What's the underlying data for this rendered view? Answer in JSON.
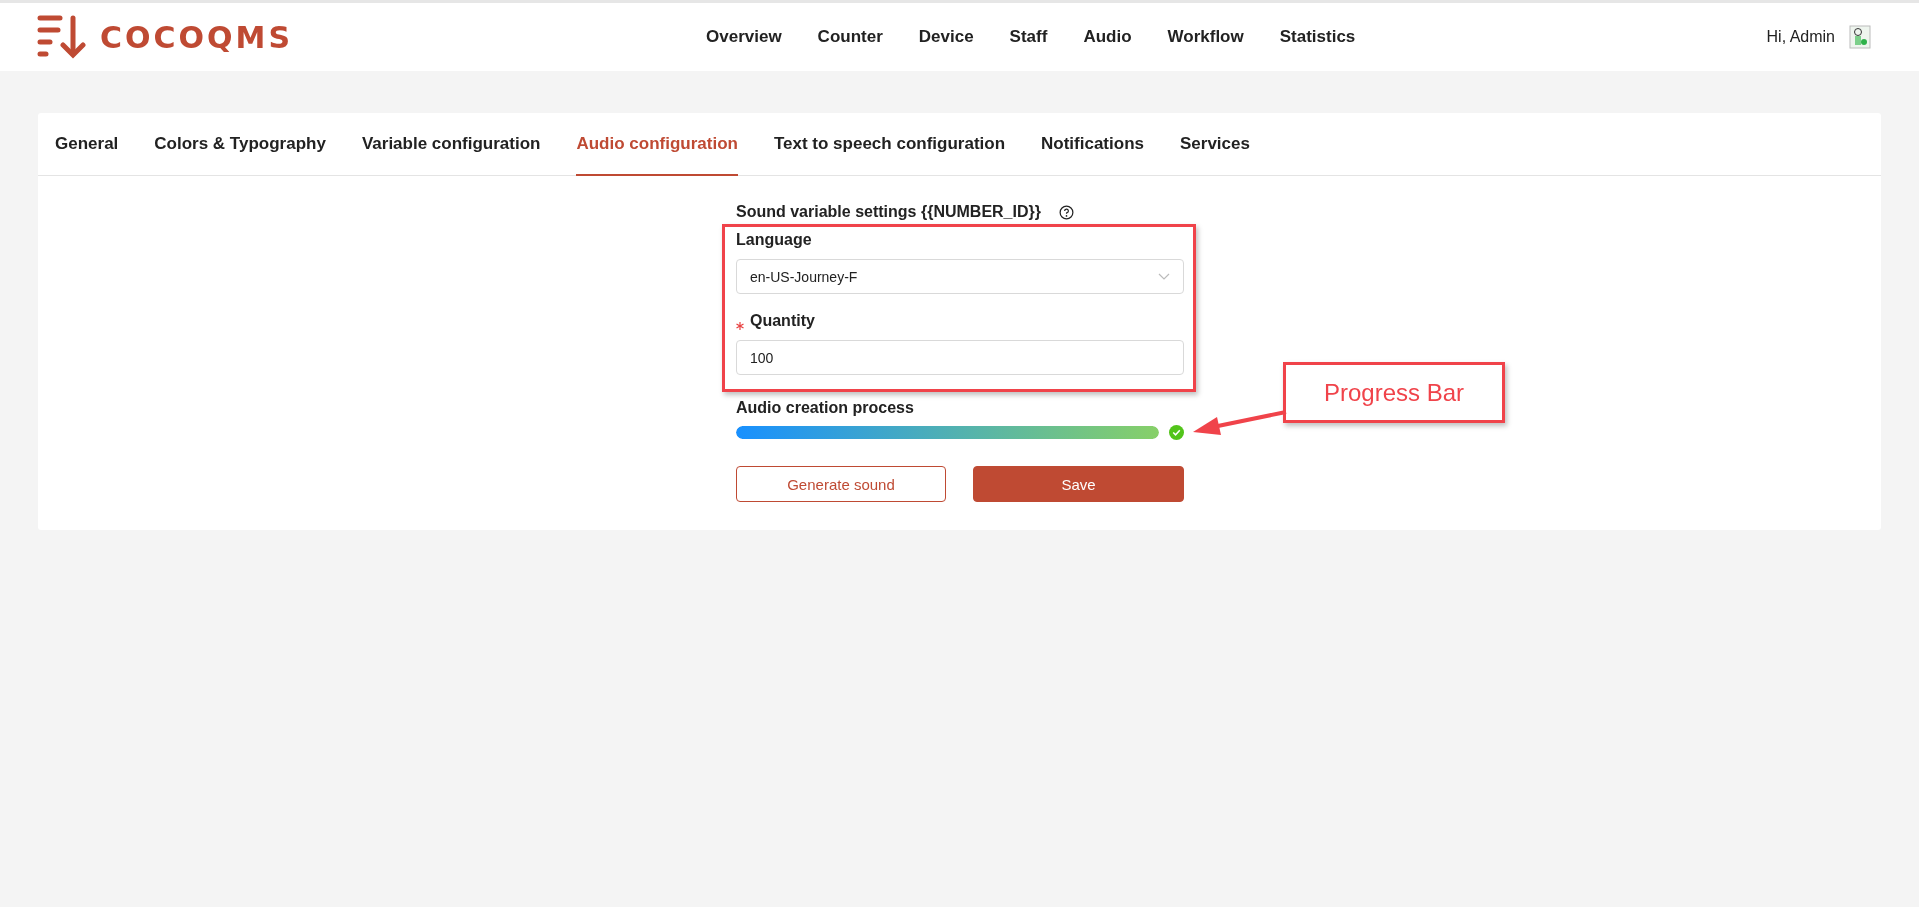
{
  "header": {
    "logo": "COCOQMS",
    "nav": [
      {
        "label": "Overview"
      },
      {
        "label": "Counter"
      },
      {
        "label": "Device"
      },
      {
        "label": "Staff"
      },
      {
        "label": "Audio"
      },
      {
        "label": "Workflow"
      },
      {
        "label": "Statistics"
      }
    ],
    "greeting": "Hi, Admin"
  },
  "tabs": [
    {
      "label": "General",
      "selected": false
    },
    {
      "label": "Colors & Typography",
      "selected": false
    },
    {
      "label": "Variable configuration",
      "selected": false
    },
    {
      "label": "Audio configuration",
      "selected": true
    },
    {
      "label": "Text to speech configuration",
      "selected": false
    },
    {
      "label": "Notifications",
      "selected": false
    },
    {
      "label": "Services",
      "selected": false
    }
  ],
  "form": {
    "title": "Sound variable settings {{NUMBER_ID}}",
    "language": {
      "label": "Language",
      "value": "en-US-Journey-F"
    },
    "quantity": {
      "label": "Quantity",
      "required": true,
      "value": "100"
    },
    "progress": {
      "label": "Audio creation process",
      "level": 1,
      "done": true
    },
    "buttons": [
      {
        "label": "Generate sound",
        "kind": "outline"
      },
      {
        "label": "Save",
        "kind": "primary"
      }
    ]
  },
  "annotation": {
    "callout": "Progress Bar"
  }
}
